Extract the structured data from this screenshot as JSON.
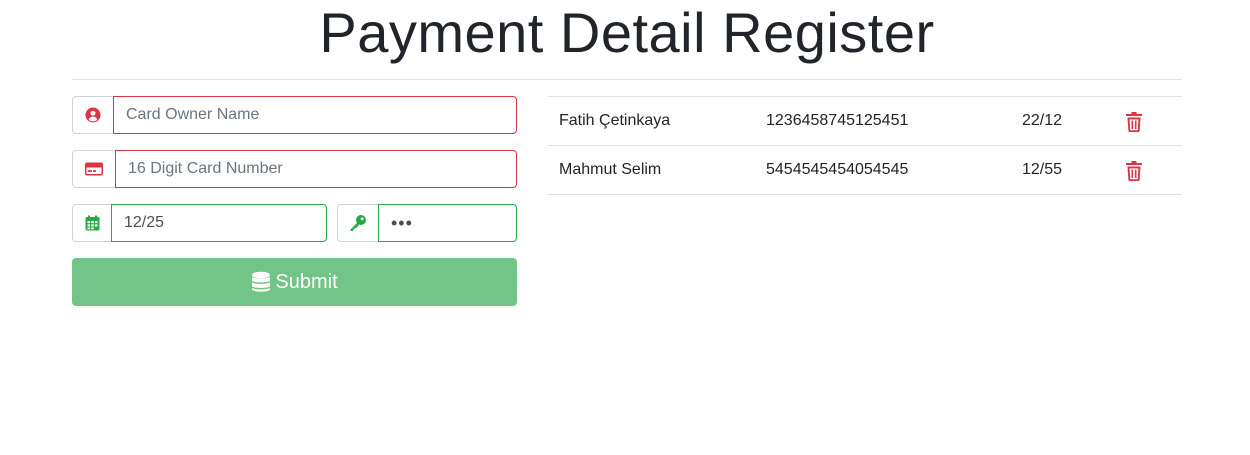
{
  "title": "Payment Detail Register",
  "colors": {
    "invalid": "#dc3545",
    "valid": "#28a745",
    "submit_bg": "#72c587"
  },
  "form": {
    "owner": {
      "icon": "user-circle-icon",
      "placeholder": "Card Owner Name",
      "value": ""
    },
    "card_number": {
      "icon": "credit-card-icon",
      "placeholder": "16 Digit Card Number",
      "value": ""
    },
    "expiry": {
      "icon": "calendar-icon",
      "placeholder": "",
      "value": "12/25"
    },
    "cvv": {
      "icon": "key-icon",
      "placeholder": "",
      "value": "•••"
    },
    "submit": {
      "icon": "database-icon",
      "label": "Submit"
    }
  },
  "payments": [
    {
      "owner": "Fatih Çetinkaya",
      "number": "1236458745125451",
      "expiry": "22/12",
      "icon": "trash-icon"
    },
    {
      "owner": "Mahmut Selim",
      "number": "5454545454054545",
      "expiry": "12/55",
      "icon": "trash-icon"
    }
  ]
}
